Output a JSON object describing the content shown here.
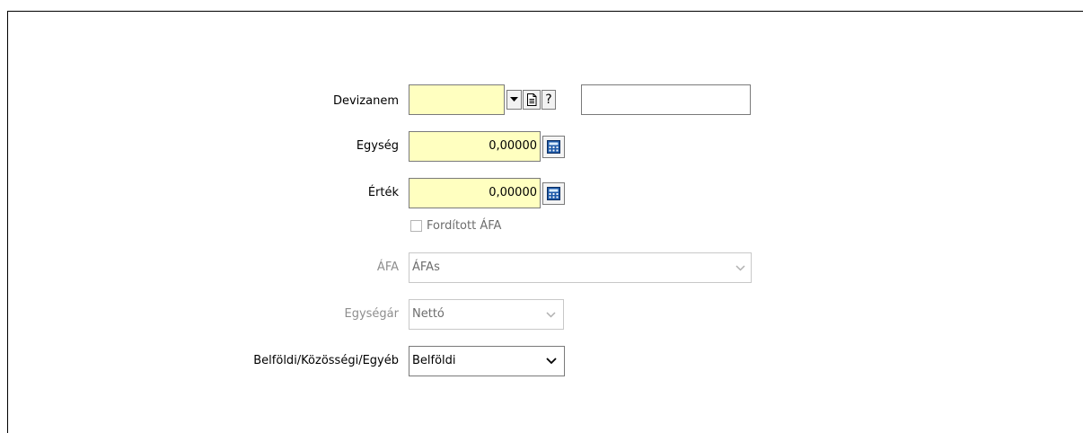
{
  "form": {
    "devizanem": {
      "label": "Devizanem",
      "value": "",
      "help": "?",
      "name_value": ""
    },
    "egyseg": {
      "label": "Egység",
      "value": "0,00000"
    },
    "ertek": {
      "label": "Érték",
      "value": "0,00000"
    },
    "forditott_afa": {
      "label": "Fordított ÁFA",
      "checked": false
    },
    "afa": {
      "label": "ÁFA",
      "value": "ÁFAs"
    },
    "egysegar": {
      "label": "Egységár",
      "value": "Nettó"
    },
    "belfoldi": {
      "label": "Belföldi/Közösségi/Egyéb",
      "value": "Belföldi"
    }
  },
  "colors": {
    "required_field": "#ffffc0",
    "disabled_text": "#8e8e8e",
    "border": "#7a7a7a"
  },
  "icons": [
    "dropdown-arrow-icon",
    "document-icon",
    "calculator-icon",
    "chevron-down-icon",
    "checkbox-icon"
  ]
}
